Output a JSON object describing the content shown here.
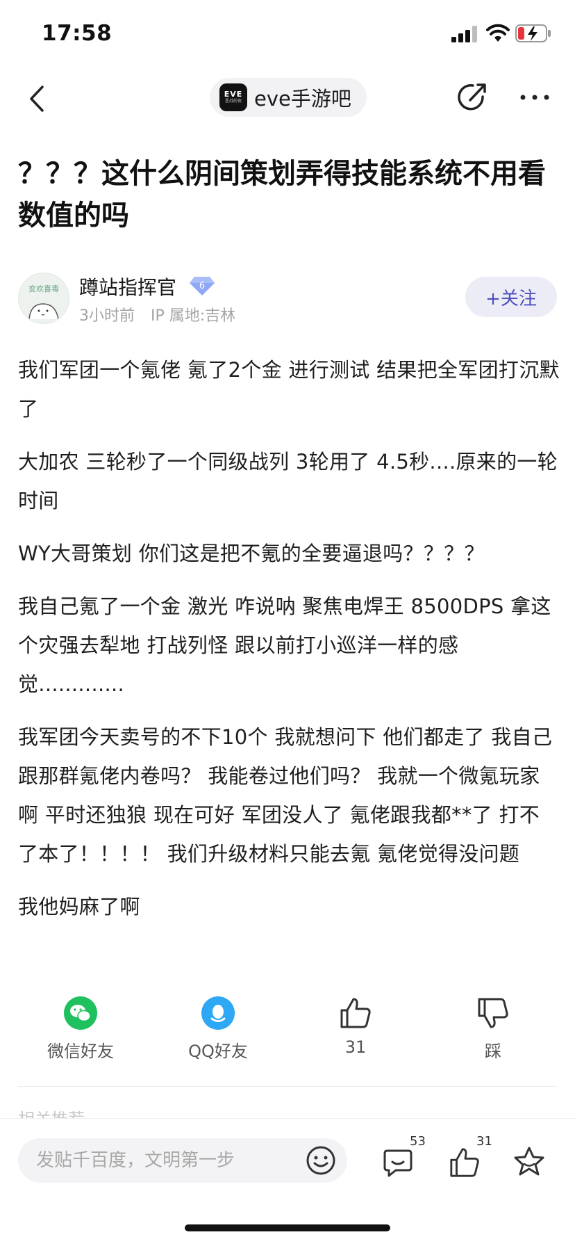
{
  "status_bar": {
    "time": "17:58"
  },
  "nav": {
    "forum_name": "eve手游吧",
    "logo_text": "EVE",
    "logo_sub": "星战前夜"
  },
  "post": {
    "title": "？？？这什么阴间策划弄得技能系统不用看数值的吗",
    "author": {
      "name": "蹲站指挥官",
      "level": "6",
      "time": "3小时前",
      "ip_location": "IP 属地:吉林",
      "avatar_text": "变欢喜毒"
    },
    "follow_label": "+关注",
    "paragraphs": [
      "我们军团一个氪佬 氪了2个金 进行测试 结果把全军团打沉默了",
      "大加农 三轮秒了一个同级战列 3轮用了 4.5秒....原来的一轮时间",
      "WY大哥策划 你们这是把不氪的全要逼退吗？？？？",
      "我自己氪了一个金 激光 咋说呐 聚焦电焊王 8500DPS 拿这个灾强去犁地 打战列怪 跟以前打小巡洋一样的感觉.............",
      "我军团今天卖号的不下10个 我就想问下 他们都走了 我自己跟那群氪佬内卷吗？ 我能卷过他们吗？ 我就一个微氪玩家啊 平时还独狼 现在可好 军团没人了 氪佬跟我都**了 打不了本了！！！！ 我们升级材料只能去氪 氪佬觉得没问题",
      "我他妈麻了啊"
    ]
  },
  "actions": {
    "wechat_label": "微信好友",
    "qq_label": "QQ好友",
    "like_count": "31",
    "dislike_label": "踩"
  },
  "related_label": "相关推荐",
  "bottom_bar": {
    "placeholder": "发贴千百度，文明第一步",
    "comment_count": "53",
    "like_count": "31"
  },
  "colors": {
    "accent": "#4c4fc0",
    "wechat": "#1fc15f",
    "qq": "#2ea7f4",
    "badge": "#6f8ff0"
  }
}
